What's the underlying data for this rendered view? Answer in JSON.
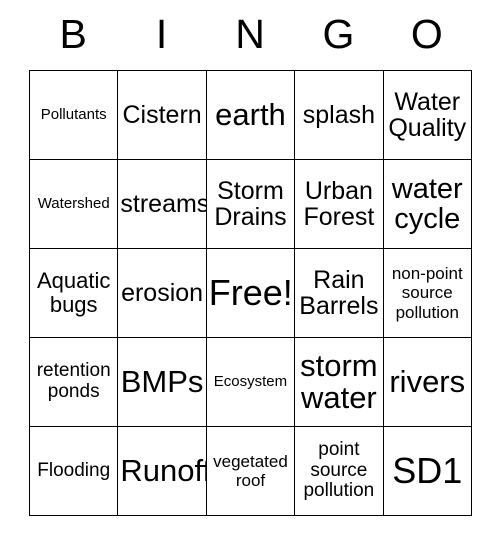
{
  "card": {
    "title": "BINGO",
    "header_letters": [
      "B",
      "I",
      "N",
      "G",
      "O"
    ],
    "free_space": "Free!",
    "colors": {
      "background": "#ffffff",
      "border": "#000000",
      "text": "#000000"
    },
    "rows": [
      [
        {
          "text": "Pollutants",
          "size": "s-xs"
        },
        {
          "text": "Cistern",
          "size": "s-xl"
        },
        {
          "text": "earth",
          "size": "s-3xl"
        },
        {
          "text": "splash",
          "size": "s-xl"
        },
        {
          "text": "Water Quality",
          "size": "s-xl"
        }
      ],
      [
        {
          "text": "Watershed",
          "size": "s-xs"
        },
        {
          "text": "streams",
          "size": "s-xl"
        },
        {
          "text": "Storm Drains",
          "size": "s-xl"
        },
        {
          "text": "Urban Forest",
          "size": "s-xl"
        },
        {
          "text": "water cycle",
          "size": "s-2xl"
        }
      ],
      [
        {
          "text": "Aquatic bugs",
          "size": "s-lg"
        },
        {
          "text": "erosion",
          "size": "s-xl"
        },
        {
          "text": "Free!",
          "size": "s-4xl"
        },
        {
          "text": "Rain Barrels",
          "size": "s-xl"
        },
        {
          "text": "non-point source pollution",
          "size": "s-sm"
        }
      ],
      [
        {
          "text": "retention ponds",
          "size": "s-md"
        },
        {
          "text": "BMPs",
          "size": "s-3xl"
        },
        {
          "text": "Ecosystem",
          "size": "s-xs"
        },
        {
          "text": "storm water",
          "size": "s-3xl"
        },
        {
          "text": "rivers",
          "size": "s-3xl"
        }
      ],
      [
        {
          "text": "Flooding",
          "size": "s-md"
        },
        {
          "text": "Runoff",
          "size": "s-3xl"
        },
        {
          "text": "vegetated roof",
          "size": "s-sm"
        },
        {
          "text": "point source pollution",
          "size": "s-md"
        },
        {
          "text": "SD1",
          "size": "s-4xl"
        }
      ]
    ]
  }
}
